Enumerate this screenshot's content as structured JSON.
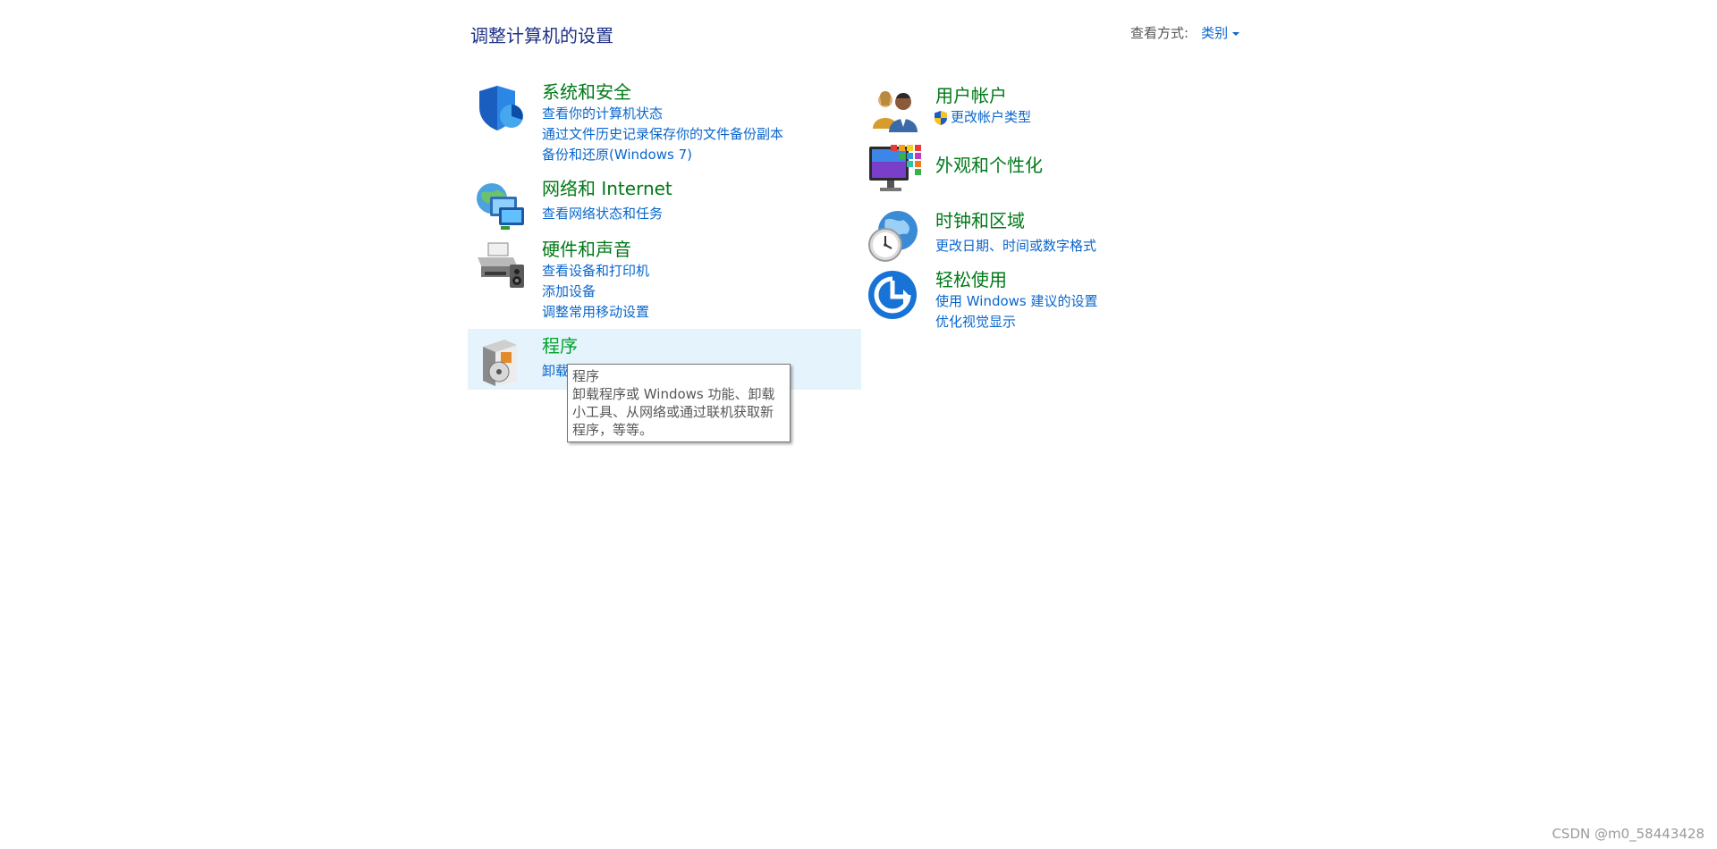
{
  "header": {
    "title": "调整计算机的设置",
    "view_by_label": "查看方式:",
    "view_by_value": "类别"
  },
  "categories_left": [
    {
      "title": "系统和安全",
      "icon": "shield-icon",
      "links": [
        "查看你的计算机状态",
        "通过文件历史记录保存你的文件备份副本",
        "备份和还原(Windows 7)"
      ]
    },
    {
      "title": "网络和 Internet",
      "icon": "network-icon",
      "links": [
        "查看网络状态和任务"
      ]
    },
    {
      "title": "硬件和声音",
      "icon": "printer-icon",
      "links": [
        "查看设备和打印机",
        "添加设备",
        "调整常用移动设置"
      ]
    },
    {
      "title": "程序",
      "icon": "programs-icon",
      "links": [
        "卸载"
      ]
    }
  ],
  "categories_right": [
    {
      "title": "用户帐户",
      "icon": "users-icon",
      "links": [
        "更改帐户类型"
      ]
    },
    {
      "title": "外观和个性化",
      "icon": "appearance-icon",
      "links": []
    },
    {
      "title": "时钟和区域",
      "icon": "clock-globe-icon",
      "links": [
        "更改日期、时间或数字格式"
      ]
    },
    {
      "title": "轻松使用",
      "icon": "ease-of-access-icon",
      "links": [
        "使用 Windows 建议的设置",
        "优化视觉显示"
      ]
    }
  ],
  "tooltip": {
    "title": "程序",
    "body": "卸载程序或 Windows 功能、卸载小工具、从网络或通过联机获取新程序，等等。"
  },
  "watermark": "CSDN @m0_58443428",
  "colors": {
    "heading_green": "#007a18",
    "link_blue": "#0a66cc",
    "title_blue": "#1e3287",
    "hover_bg": "#e5f3fd"
  }
}
